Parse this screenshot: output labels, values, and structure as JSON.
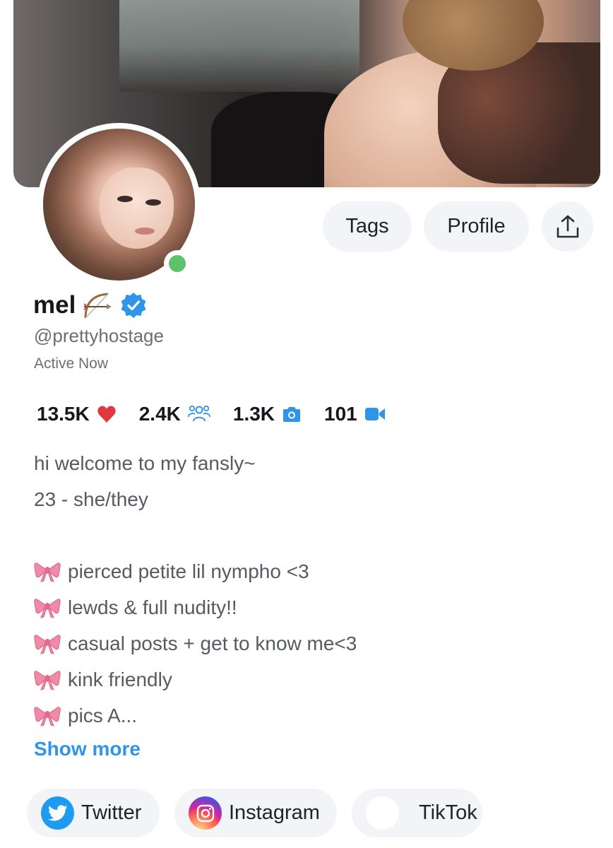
{
  "profile": {
    "name": "mel",
    "name_emoji": "bow-and-arrow",
    "verified": true,
    "handle": "@prettyhostage",
    "status": "Active Now",
    "online": true
  },
  "actions": {
    "tags_label": "Tags",
    "profile_label": "Profile",
    "share_icon": "share-icon"
  },
  "stats": [
    {
      "value": "13.5K",
      "icon": "heart-icon",
      "color": "#e0383e"
    },
    {
      "value": "2.4K",
      "icon": "followers-icon",
      "color": "#2f95e8"
    },
    {
      "value": "1.3K",
      "icon": "camera-icon",
      "color": "#2f95e8"
    },
    {
      "value": "101",
      "icon": "video-icon",
      "color": "#2f95e8"
    }
  ],
  "bio": {
    "lines": [
      {
        "text": "hi welcome to my fansly~",
        "bow": false
      },
      {
        "text": "23 - she/they",
        "bow": false
      },
      {
        "text": "",
        "bow": false
      },
      {
        "text": "pierced petite lil nympho <3",
        "bow": true
      },
      {
        "text": "lewds & full nudity!!",
        "bow": true
      },
      {
        "text": "casual posts + get to know me<3",
        "bow": true
      },
      {
        "text": "kink friendly",
        "bow": true
      },
      {
        "text": "pics A...",
        "bow": true
      }
    ],
    "show_more": "Show more"
  },
  "socials": [
    {
      "label": "Twitter",
      "icon": "twitter-icon"
    },
    {
      "label": "Instagram",
      "icon": "instagram-icon"
    },
    {
      "label": "TikTok",
      "icon": "tiktok-icon"
    }
  ],
  "colors": {
    "accent": "#2f95e8",
    "online": "#5dc26a",
    "heart": "#e0383e"
  }
}
